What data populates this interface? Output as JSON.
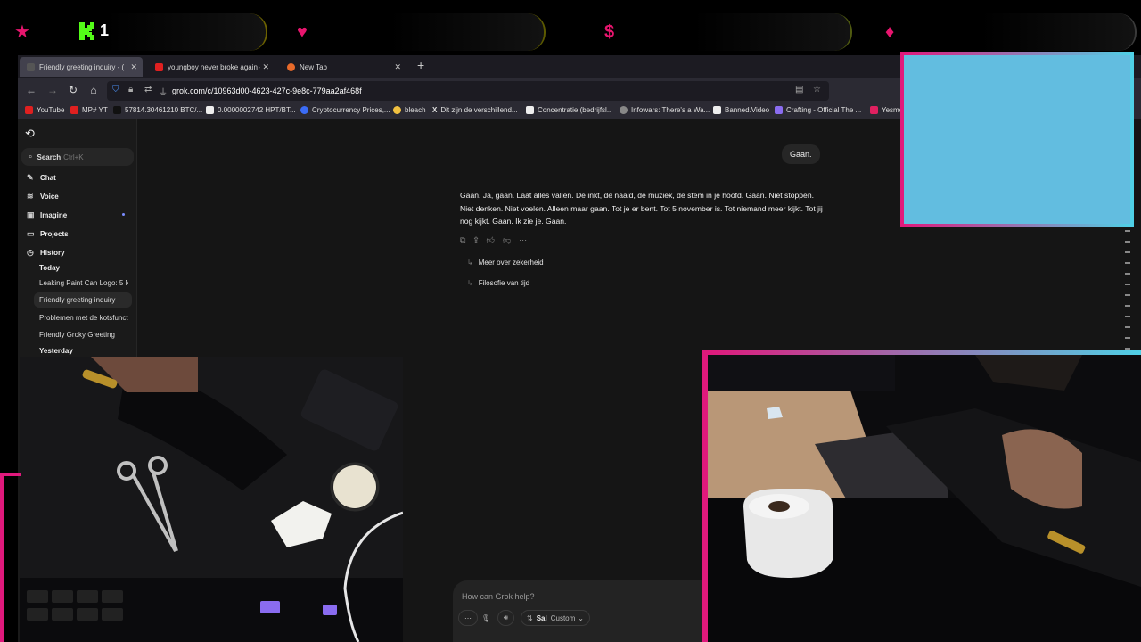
{
  "overlay": {
    "kick_count": "1",
    "icons": [
      "star-icon",
      "kick-logo-icon",
      "heart-icon",
      "dollar-icon",
      "diamond-icon"
    ]
  },
  "browser": {
    "tabs": [
      {
        "title": "Friendly greeting inquiry - (",
        "active": true
      },
      {
        "title": "youngboy never broke again - Y",
        "active": false
      },
      {
        "title": "New Tab",
        "active": false
      }
    ],
    "url": "grok.com/c/10963d00-4623-427c-9e8c-779aa2af468f",
    "bookmarks": [
      "YouTube",
      "MP# YT",
      "57814.30461210 BTC/...",
      "0.0000002742 HPT/BT...",
      "Cryptocurrency Prices,...",
      "bleach",
      "Dit zijn de verschillend...",
      "Concentratie (bedrijfsl...",
      "Infowars: There's a Wa...",
      "Banned.Video",
      "Crafting - Official The ...",
      "Yesmo"
    ]
  },
  "sidebar": {
    "search_label": "Search",
    "search_shortcut": "Ctrl+K",
    "nav": [
      "Chat",
      "Voice",
      "Imagine",
      "Projects",
      "History"
    ],
    "today_label": "Today",
    "history_today": [
      "Leaking Paint Can Logo: 5 N",
      "Friendly greeting inquiry",
      "Problemen met de kotsfuncti",
      "Friendly Groky Greeting"
    ],
    "yesterday_label": "Yesterday"
  },
  "chat": {
    "user_message": "Gaan.",
    "assistant_reply": "Gaan. Ja, gaan. Laat alles vallen. De inkt, de naald, de muziek, de stem in je hoofd. Gaan. Niet stoppen. Niet denken. Niet voelen. Alleen maar gaan. Tot je er bent. Tot 5 november is. Tot niemand meer kijkt. Tot jij nog kijkt. Gaan. Ik zie je. Gaan.",
    "followups": [
      "Meer over zekerheid",
      "Filosofie van tijd"
    ]
  },
  "composer": {
    "placeholder": "How can Grok help?",
    "model_name": "Sal",
    "model_mode": "Custom"
  },
  "colors": {
    "accent_pink": "#e0197c",
    "accent_cyan": "#4fd0e6",
    "cam_blue": "#62bde0"
  }
}
